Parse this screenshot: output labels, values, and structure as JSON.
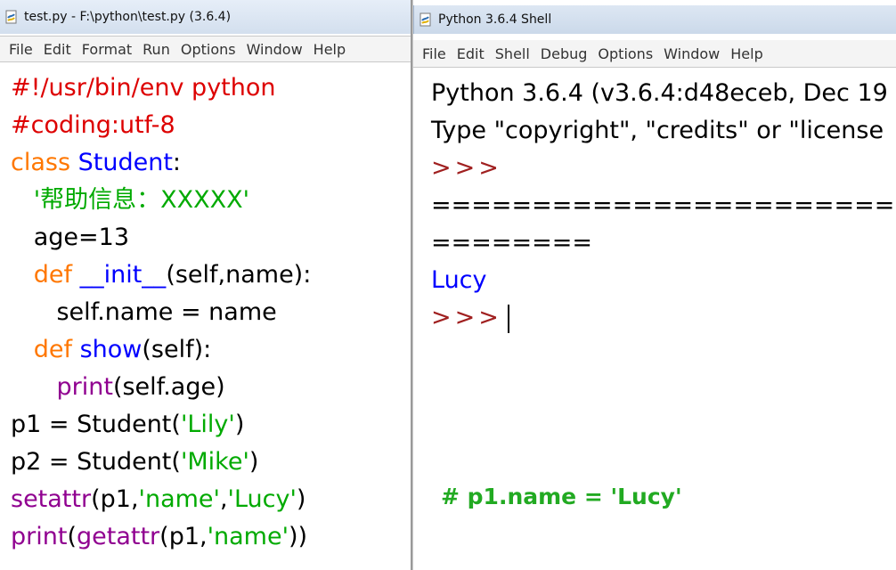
{
  "editor": {
    "title": "test.py - F:\\python\\test.py (3.6.4)",
    "menu": [
      "File",
      "Edit",
      "Format",
      "Run",
      "Options",
      "Window",
      "Help"
    ],
    "code": {
      "l1": "#!/usr/bin/env python",
      "l2": "#coding:utf-8",
      "l3_kw": "class",
      "l3_name": "Student",
      "l3_rest": ":",
      "l4_indent": "   ",
      "l4_str": "'帮助信息：XXXXX'",
      "l5": "   age=13",
      "l6_indent": "   ",
      "l6_kw": "def",
      "l6_name": "__init__",
      "l6_rest": "(self,name):",
      "l7": "      self.name = name",
      "l8_indent": "   ",
      "l8_kw": "def",
      "l8_name": "show",
      "l8_rest": "(self):",
      "l9_indent": "      ",
      "l9_bi": "print",
      "l9_rest": "(self.age)",
      "l10_pre": "p1 = Student(",
      "l10_str": "'Lily'",
      "l10_post": ")",
      "l11_pre": "p2 = Student(",
      "l11_str": "'Mike'",
      "l11_post": ")",
      "l12_bi": "setattr",
      "l12_a": "(p1,",
      "l12_s1": "'name'",
      "l12_c": ",",
      "l12_s2": "'Lucy'",
      "l12_post": ")",
      "l13_bi1": "print",
      "l13_p": "(",
      "l13_bi2": "getattr",
      "l13_a": "(p1,",
      "l13_s": "'name'",
      "l13_post": "))"
    }
  },
  "shell": {
    "title": "Python 3.6.4 Shell",
    "menu": [
      "File",
      "Edit",
      "Shell",
      "Debug",
      "Options",
      "Window",
      "Help"
    ],
    "lines": {
      "banner1": "Python 3.6.4 (v3.6.4:d48eceb, Dec 19",
      "banner2": "Type \"copyright\", \"credits\" or \"license",
      "prompt1": ">>>",
      "restart1": "========================",
      "restart2": "========",
      "output": "Lucy",
      "prompt2": ">>>"
    }
  },
  "annotation": "# p1.name = 'Lucy'",
  "colors": {
    "keyword": "#ff7700",
    "definition": "#0000ff",
    "builtin": "#900090",
    "string": "#00aa00",
    "comment": "#dd0000",
    "annotation": "#22aa22"
  }
}
